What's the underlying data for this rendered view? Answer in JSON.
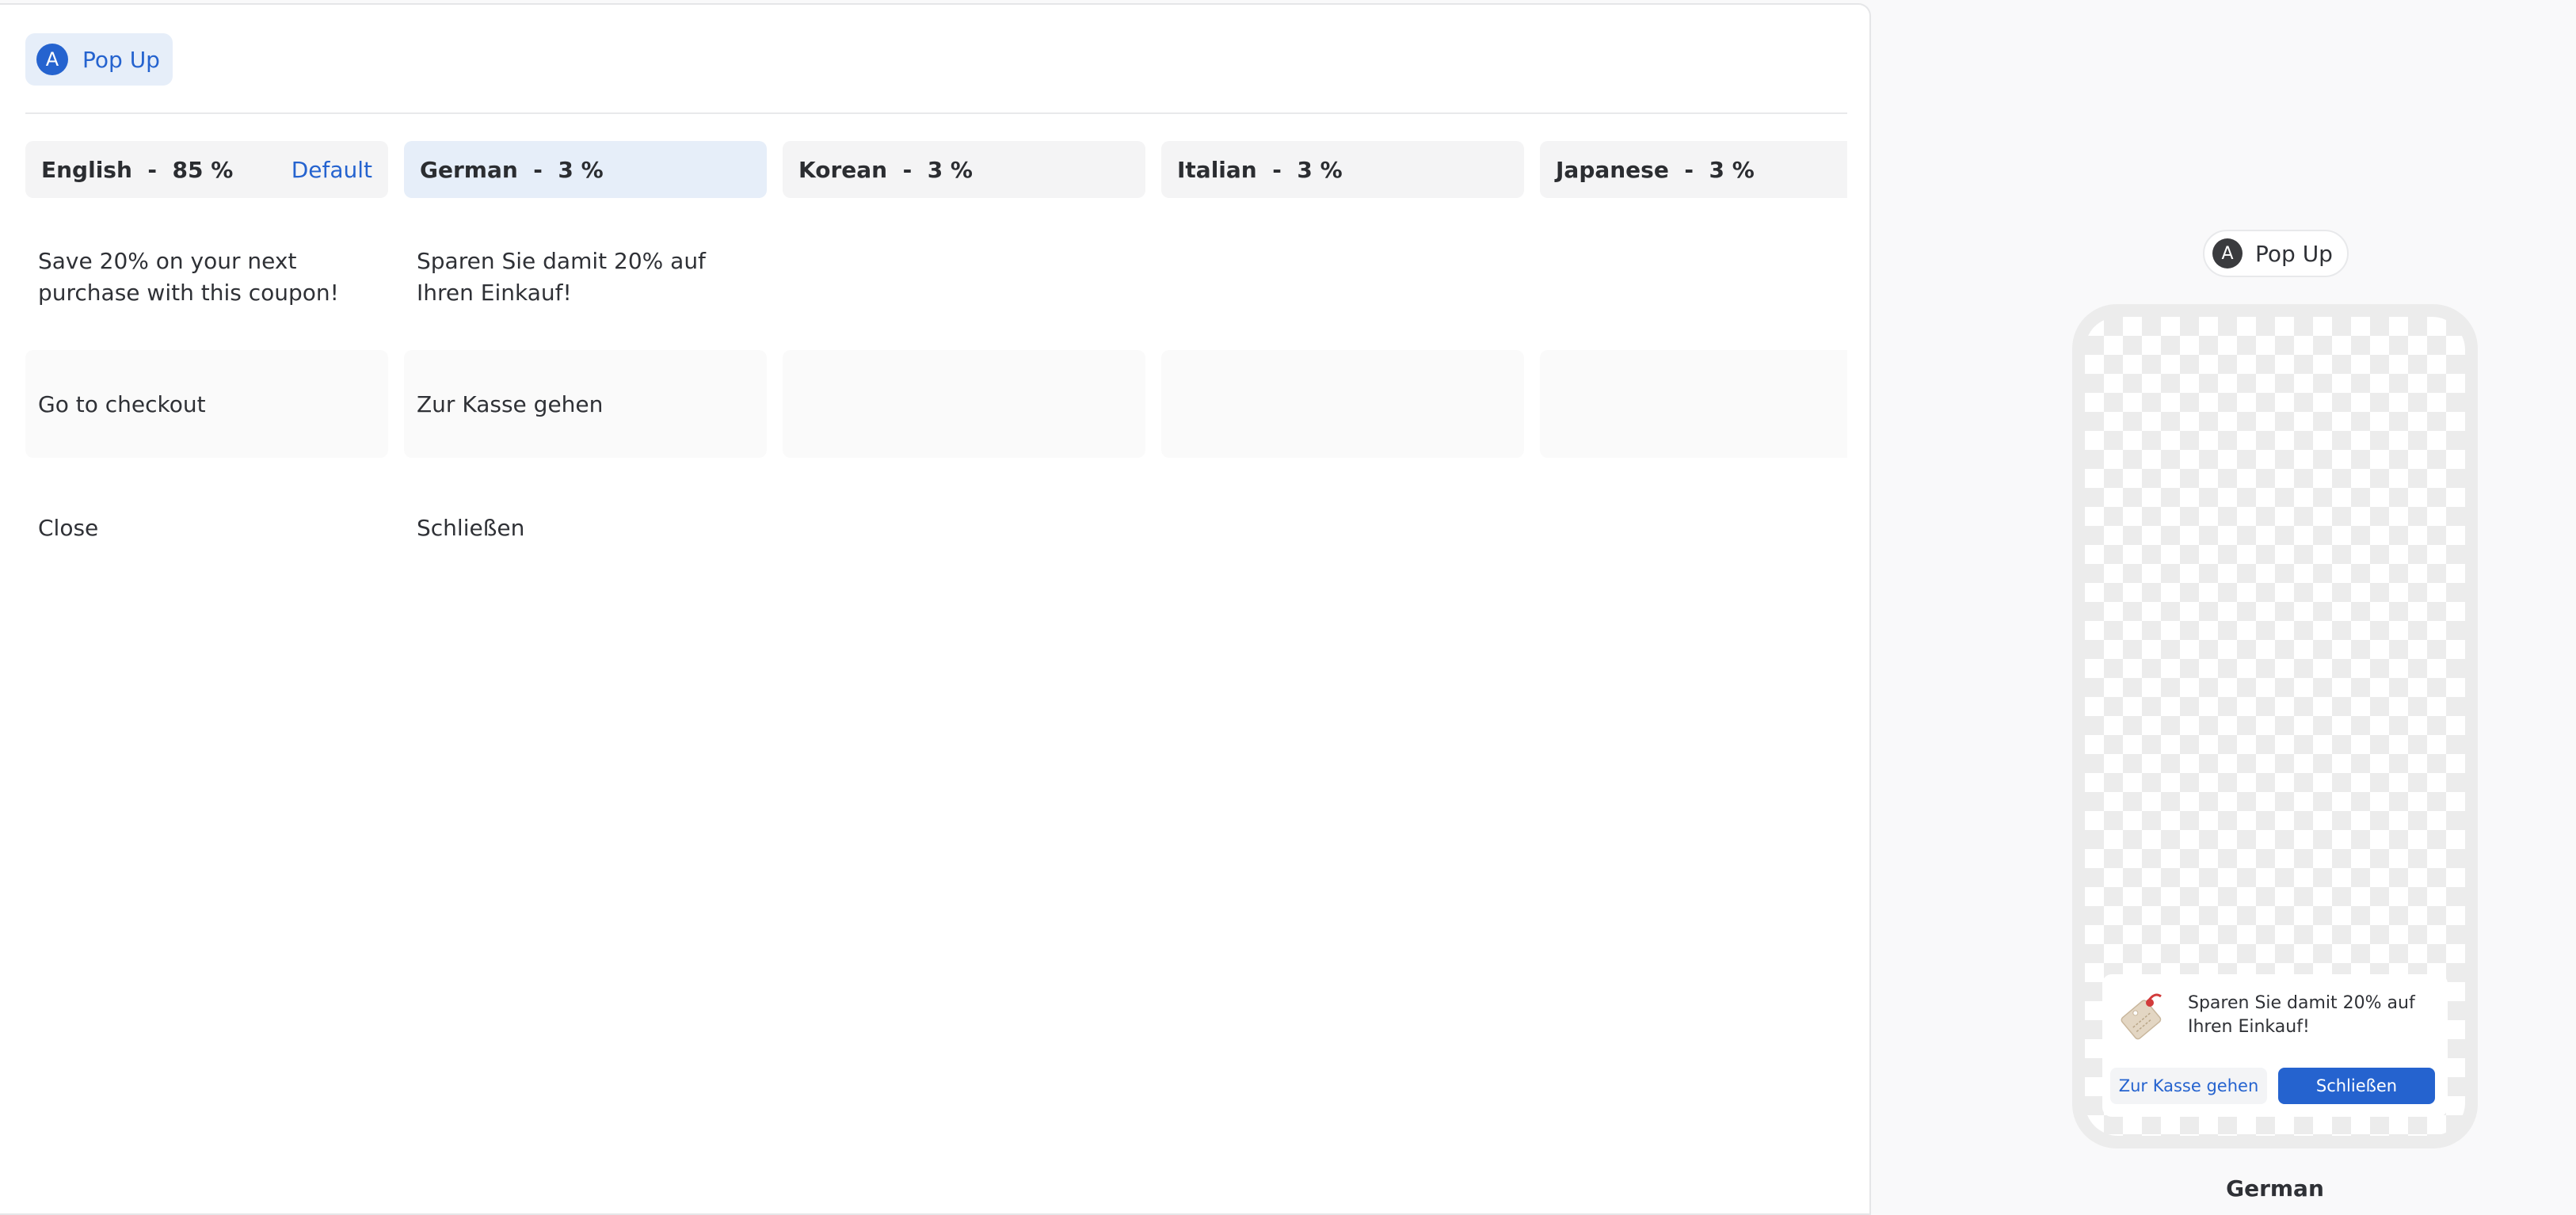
{
  "editor": {
    "component_chip": {
      "badge": "A",
      "label": "Pop Up"
    },
    "languages": [
      {
        "name": "English",
        "percent": "85 %",
        "default_label": "Default",
        "message": "Save 20% on your next purchase with this coupon!",
        "primary_button": "Go to checkout",
        "secondary_button": "Close"
      },
      {
        "name": "German",
        "percent": "3 %",
        "default_label": "",
        "message": "Sparen Sie damit 20% auf Ihren Einkauf!",
        "primary_button": "Zur Kasse gehen",
        "secondary_button": "Schließen"
      },
      {
        "name": "Korean",
        "percent": "3 %",
        "default_label": "",
        "message": "",
        "primary_button": "",
        "secondary_button": ""
      },
      {
        "name": "Italian",
        "percent": "3 %",
        "default_label": "",
        "message": "",
        "primary_button": "",
        "secondary_button": ""
      },
      {
        "name": "Japanese",
        "percent": "3 %",
        "default_label": "",
        "message": "",
        "primary_button": "",
        "secondary_button": ""
      }
    ],
    "separator": "-",
    "active_language_index": 1
  },
  "preview": {
    "chip": {
      "badge": "A",
      "label": "Pop Up"
    },
    "popup": {
      "icon": "coupon-tag-icon",
      "message": "Sparen Sie damit 20% auf Ihren Einkauf!",
      "secondary_button": "Zur Kasse gehen",
      "primary_button": "Schließen"
    },
    "language": "German"
  },
  "colors": {
    "accent": "#2563cf",
    "active_tab_bg": "#e6eef9",
    "tab_bg": "#f4f4f5"
  }
}
